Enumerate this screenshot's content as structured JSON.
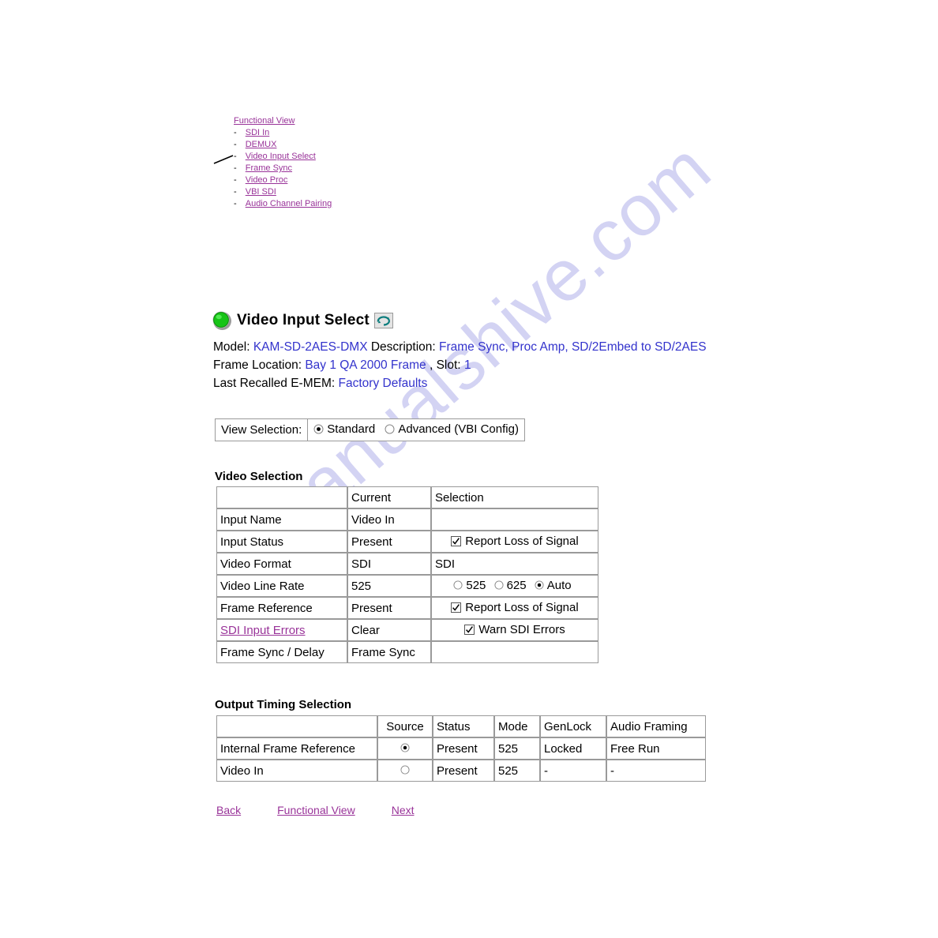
{
  "watermark": {
    "text": "manualshive.com"
  },
  "nav": {
    "root": {
      "label": "Functional View"
    },
    "items": [
      {
        "label": "SDI In"
      },
      {
        "label": "DEMUX"
      },
      {
        "label": "Video Input Select"
      },
      {
        "label": "Frame Sync"
      },
      {
        "label": "Video Proc"
      },
      {
        "label": "VBI SDI"
      },
      {
        "label": "Audio Channel Pairing"
      }
    ]
  },
  "header": {
    "title": "Video Input Select",
    "led_color": "#22cc22",
    "refresh_icon": "refresh-icon",
    "status_icon": "status-led-icon"
  },
  "info": {
    "model_label": "Model:",
    "model_value": "KAM-SD-2AES-DMX",
    "description_label": "Description:",
    "description_value": "Frame Sync, Proc Amp, SD/2Embed to SD/2AES",
    "frame_location_label": "Frame Location:",
    "frame_location_value": "Bay 1 QA 2000 Frame",
    "slot_label": ", Slot:",
    "slot_value": "1",
    "emem_label": "Last Recalled E-MEM:",
    "emem_value": "Factory Defaults"
  },
  "view_selection": {
    "label": "View Selection:",
    "options": [
      {
        "label": "Standard",
        "selected": true
      },
      {
        "label": "Advanced (VBI Config)",
        "selected": false
      }
    ]
  },
  "video_selection": {
    "heading": "Video Selection",
    "columns": [
      "",
      "Current",
      "Selection"
    ],
    "rows": [
      {
        "name": "Input Name",
        "name_is_link": false,
        "current": "Video In",
        "selection_type": "empty",
        "selection_text": ""
      },
      {
        "name": "Input Status",
        "name_is_link": false,
        "current": "Present",
        "selection_type": "checkbox",
        "selection_text": "Report Loss of Signal",
        "checked": true
      },
      {
        "name": "Video Format",
        "name_is_link": false,
        "current": "SDI",
        "selection_type": "text-blue",
        "selection_text": "SDI"
      },
      {
        "name": "Video Line Rate",
        "name_is_link": false,
        "current": "525",
        "selection_type": "radios",
        "radios": [
          {
            "label": "525",
            "selected": false
          },
          {
            "label": "625",
            "selected": false
          },
          {
            "label": "Auto",
            "selected": true
          }
        ]
      },
      {
        "name": "Frame Reference",
        "name_is_link": false,
        "current": "Present",
        "selection_type": "checkbox",
        "selection_text": "Report Loss of Signal",
        "checked": true
      },
      {
        "name": "SDI Input Errors",
        "name_is_link": true,
        "current": "Clear",
        "selection_type": "checkbox",
        "selection_text": "Warn SDI Errors",
        "checked": true
      },
      {
        "name": "Frame Sync / Delay",
        "name_is_link": false,
        "current": "Frame Sync",
        "selection_type": "empty",
        "selection_text": ""
      }
    ]
  },
  "output_timing": {
    "heading": "Output Timing Selection",
    "columns": [
      "",
      "Source",
      "Status",
      "Mode",
      "GenLock",
      "Audio Framing"
    ],
    "rows": [
      {
        "name": "Internal Frame Reference",
        "selected": true,
        "status": "Present",
        "mode": "525",
        "genlock": "Locked",
        "audio_framing": "Free Run"
      },
      {
        "name": "Video In",
        "selected": false,
        "status": "Present",
        "mode": "525",
        "genlock": "-",
        "audio_framing": "-"
      }
    ]
  },
  "footer": {
    "back": "Back",
    "functional_view": "Functional View",
    "next": "Next"
  }
}
